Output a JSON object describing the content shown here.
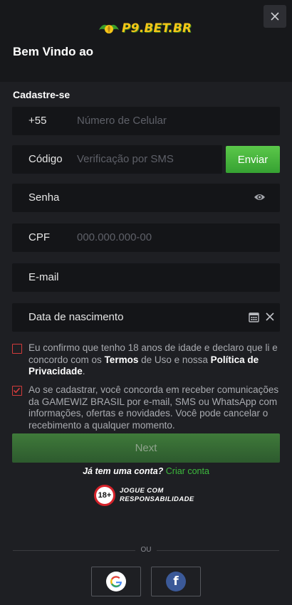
{
  "header": {
    "logo_text": "P9.BET.BR",
    "welcome": "Bem Vindo ao"
  },
  "form": {
    "section_title": "Cadastre-se",
    "phone": {
      "prefix": "+55",
      "placeholder": "Número de Celular"
    },
    "code": {
      "label": "Código",
      "placeholder": "Verificação por SMS",
      "send_label": "Enviar"
    },
    "password": {
      "label": "Senha"
    },
    "cpf": {
      "label": "CPF",
      "placeholder": "000.000.000-00"
    },
    "email": {
      "label": "E-mail"
    },
    "birthdate": {
      "label": "Data de nascimento"
    },
    "terms": {
      "text_a": "Eu confirmo que tenho 18 anos de idade e declaro que li e concordo com os ",
      "terms_link": "Termos",
      "text_b": " de Uso e nossa ",
      "privacy_link": "Política de Privacidade",
      "text_c": ".",
      "checked": false
    },
    "marketing": {
      "text": "Ao se cadastrar, você concorda em receber comunicações da GAMEWIZ BRASIL por e-mail, SMS ou WhatsApp com informações, ofertas e novidades. Você pode cancelar o recebimento a qualquer momento.",
      "checked": true
    },
    "next_label": "Next",
    "login_prompt": "Já tem uma conta?",
    "login_link": "Criar conta"
  },
  "responsible": {
    "badge": "18+",
    "line1": "JOGUE COM",
    "line2": "RESPONSABILIDADE"
  },
  "social": {
    "divider_text": "OU",
    "providers": [
      "google-icon",
      "facebook-icon"
    ],
    "facebook_letter": "f"
  },
  "colors": {
    "accent_green": "#36a232",
    "checkbox_red": "#d23b3b",
    "brand_gold": "#f5c518"
  }
}
